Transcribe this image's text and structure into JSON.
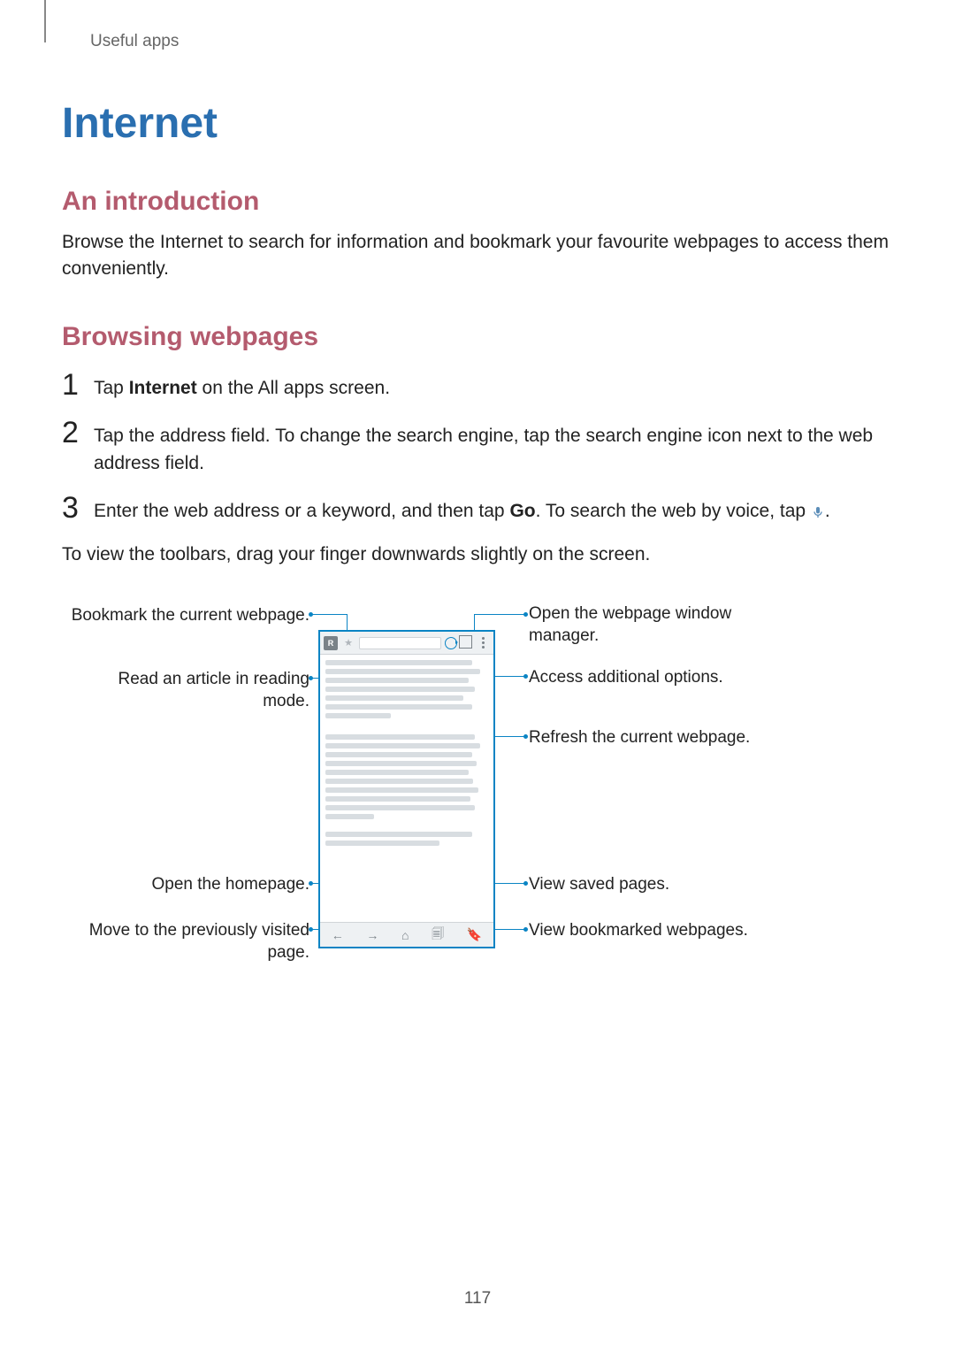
{
  "breadcrumb": "Useful apps",
  "title": "Internet",
  "section1": {
    "heading": "An introduction",
    "body": "Browse the Internet to search for information and bookmark your favourite webpages to access them conveniently."
  },
  "section2": {
    "heading": "Browsing webpages",
    "steps": [
      {
        "num": "1",
        "pre": "Tap ",
        "bold": "Internet",
        "post": " on the All apps screen."
      },
      {
        "num": "2",
        "pre": "Tap the address field. To change the search engine, tap the search engine icon next to the web address field.",
        "bold": "",
        "post": ""
      },
      {
        "num": "3",
        "pre": "Enter the web address or a keyword, and then tap ",
        "bold": "Go",
        "post": ". To search the web by voice, tap "
      }
    ],
    "after_steps": "To view the toolbars, drag your finger downwards slightly on the screen."
  },
  "callouts_left": [
    "Bookmark the current webpage.",
    "Read an article in reading mode.",
    "Open the homepage.",
    "Move to the previously visited page."
  ],
  "callouts_right": [
    "Open the webpage window manager.",
    "Access additional options.",
    "Refresh the current webpage.",
    "View saved pages.",
    "View bookmarked webpages."
  ],
  "page_number": "117"
}
